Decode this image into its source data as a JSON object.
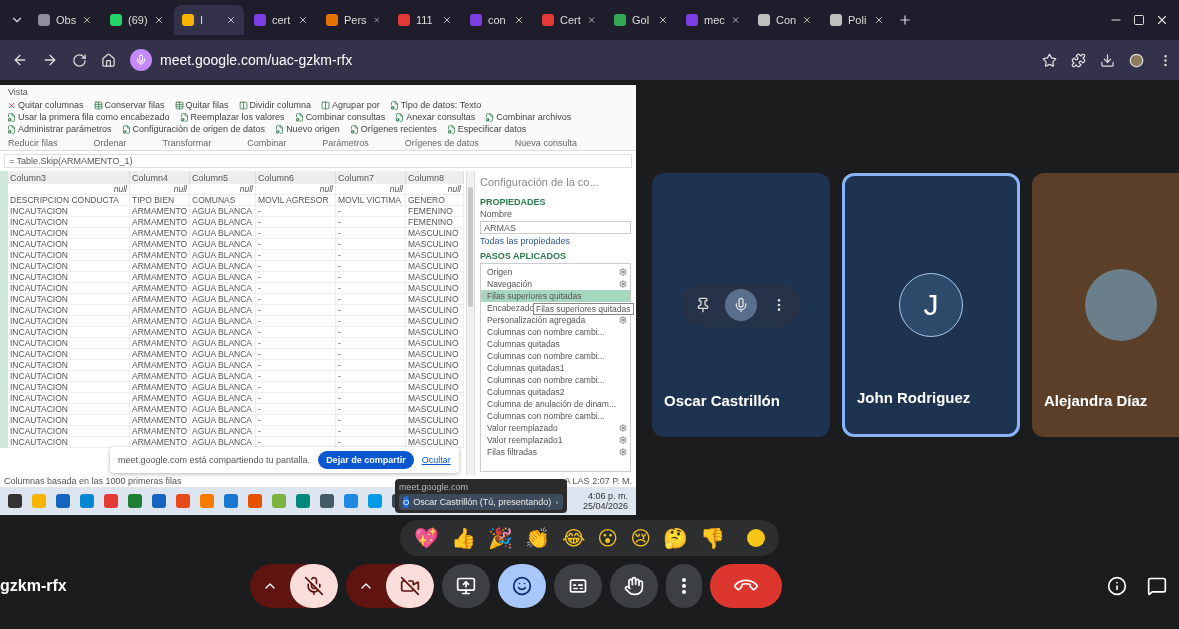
{
  "browser": {
    "tabs": [
      {
        "label": "Obs",
        "color": "#8e8e9e",
        "selected": false
      },
      {
        "label": "(69)",
        "color": "#25d366",
        "selected": false
      },
      {
        "label": "I",
        "color": "#f4b400",
        "selected": true
      },
      {
        "label": "cert",
        "color": "#7b3fe4",
        "selected": false
      },
      {
        "label": "Pers",
        "color": "#e37400",
        "selected": false
      },
      {
        "label": "111",
        "color": "#e53935",
        "selected": false
      },
      {
        "label": "con",
        "color": "#7b3fe4",
        "selected": false
      },
      {
        "label": "Cert",
        "color": "#e53935",
        "selected": false
      },
      {
        "label": "Gol",
        "color": "#34a853",
        "selected": false
      },
      {
        "label": "mec",
        "color": "#7b3fe4",
        "selected": false
      },
      {
        "label": "Con",
        "color": "#c0c0c0",
        "selected": false
      },
      {
        "label": "Poli",
        "color": "#c0c0c0",
        "selected": false
      }
    ],
    "url": "meet.google.com/uac-gzkm-rfx"
  },
  "shared_screen": {
    "ribbon": {
      "tab": "Vista",
      "buttons": [
        "Quitar columnas",
        "Conservar filas",
        "Quitar filas",
        "Dividir columna",
        "Agrupar por",
        "Tipo de datos: Texto",
        "Usar la primera fila como encabezado",
        "Reemplazar los valores",
        "Combinar consultas",
        "Anexar consultas",
        "Combinar archivos",
        "Administrar parámetros",
        "Configuración de origen de datos",
        "Nuevo origen",
        "Orígenes recientes",
        "Especificar datos"
      ],
      "groups": [
        "Reducir filas",
        "Ordenar",
        "Transformar",
        "Combinar",
        "Parámetros",
        "Orígenes de datos",
        "Nueva consulta"
      ]
    },
    "formula": "= Table.Skip(ARMAMENTO_1)",
    "table": {
      "columns": [
        "Column3",
        "Column4",
        "Column5",
        "Column6",
        "Column7",
        "Column8"
      ],
      "null_row": [
        "null",
        "null",
        "null",
        "null",
        "null",
        "null"
      ],
      "rows": [
        [
          "DESCRIPCION CONDUCTA",
          "TIPO BIEN",
          "COMUNAS",
          "MOVIL AGRESOR",
          "MOVIL VICTIMA",
          "GENERO"
        ],
        [
          "INCAUTACION",
          "ARMAMENTO",
          "AGUA BLANCA",
          "-",
          "-",
          "FEMENINO"
        ],
        [
          "INCAUTACION",
          "ARMAMENTO",
          "AGUA BLANCA",
          "-",
          "-",
          "FEMENINO"
        ],
        [
          "INCAUTACION",
          "ARMAMENTO",
          "AGUA BLANCA",
          "-",
          "-",
          "MASCULINO"
        ],
        [
          "INCAUTACION",
          "ARMAMENTO",
          "AGUA BLANCA",
          "-",
          "-",
          "MASCULINO"
        ],
        [
          "INCAUTACION",
          "ARMAMENTO",
          "AGUA BLANCA",
          "-",
          "-",
          "MASCULINO"
        ],
        [
          "INCAUTACION",
          "ARMAMENTO",
          "AGUA BLANCA",
          "-",
          "-",
          "MASCULINO"
        ],
        [
          "INCAUTACION",
          "ARMAMENTO",
          "AGUA BLANCA",
          "-",
          "-",
          "MASCULINO"
        ],
        [
          "INCAUTACION",
          "ARMAMENTO",
          "AGUA BLANCA",
          "-",
          "-",
          "MASCULINO"
        ],
        [
          "INCAUTACION",
          "ARMAMENTO",
          "AGUA BLANCA",
          "-",
          "-",
          "MASCULINO"
        ],
        [
          "INCAUTACION",
          "ARMAMENTO",
          "AGUA BLANCA",
          "-",
          "-",
          "MASCULINO"
        ],
        [
          "INCAUTACION",
          "ARMAMENTO",
          "AGUA BLANCA",
          "-",
          "-",
          "MASCULINO"
        ],
        [
          "INCAUTACION",
          "ARMAMENTO",
          "AGUA BLANCA",
          "-",
          "-",
          "MASCULINO"
        ],
        [
          "INCAUTACION",
          "ARMAMENTO",
          "AGUA BLANCA",
          "-",
          "-",
          "MASCULINO"
        ],
        [
          "INCAUTACION",
          "ARMAMENTO",
          "AGUA BLANCA",
          "-",
          "-",
          "MASCULINO"
        ],
        [
          "INCAUTACION",
          "ARMAMENTO",
          "AGUA BLANCA",
          "-",
          "-",
          "MASCULINO"
        ],
        [
          "INCAUTACION",
          "ARMAMENTO",
          "AGUA BLANCA",
          "-",
          "-",
          "MASCULINO"
        ],
        [
          "INCAUTACION",
          "ARMAMENTO",
          "AGUA BLANCA",
          "-",
          "-",
          "MASCULINO"
        ],
        [
          "INCAUTACION",
          "ARMAMENTO",
          "AGUA BLANCA",
          "-",
          "-",
          "MASCULINO"
        ],
        [
          "INCAUTACION",
          "ARMAMENTO",
          "AGUA BLANCA",
          "-",
          "-",
          "MASCULINO"
        ],
        [
          "INCAUTACION",
          "ARMAMENTO",
          "AGUA BLANCA",
          "-",
          "-",
          "MASCULINO"
        ],
        [
          "INCAUTACION",
          "ARMAMENTO",
          "AGUA BLANCA",
          "-",
          "-",
          "MASCULINO"
        ],
        [
          "INCAUTACION",
          "ARMAMENTO",
          "AGUA BLANCA",
          "-",
          "-",
          "MASCULINO"
        ]
      ]
    },
    "query_settings": {
      "title": "Configuración de la co...",
      "properties_heading": "PROPIEDADES",
      "name_label": "Nombre",
      "name_value": "ARMAS",
      "all_properties": "Todas las propiedades",
      "steps_heading": "PASOS APLICADOS",
      "steps": [
        {
          "label": "Origen",
          "settings": true,
          "selected": false
        },
        {
          "label": "Navegación",
          "settings": true,
          "selected": false
        },
        {
          "label": "Filas superiores quitadas",
          "settings": false,
          "selected": true
        },
        {
          "label": "Encabezado",
          "settings": false,
          "selected": false
        },
        {
          "label": "Personalización agregada",
          "settings": true,
          "selected": false
        },
        {
          "label": "Columnas con nombre cambi...",
          "settings": false,
          "selected": false
        },
        {
          "label": "Columnas quitadas",
          "settings": false,
          "selected": false
        },
        {
          "label": "Columnas con nombre cambi...",
          "settings": false,
          "selected": false
        },
        {
          "label": "Columnas quitadas1",
          "settings": false,
          "selected": false
        },
        {
          "label": "Columnas con nombre cambi...",
          "settings": false,
          "selected": false
        },
        {
          "label": "Columnas quitadas2",
          "settings": false,
          "selected": false
        },
        {
          "label": "Columna de anulación de dinam...",
          "settings": false,
          "selected": false
        },
        {
          "label": "Columnas con nombre cambi...",
          "settings": false,
          "selected": false
        },
        {
          "label": "Valor reemplazado",
          "settings": true,
          "selected": false
        },
        {
          "label": "Valor reemplazado1",
          "settings": true,
          "selected": false
        },
        {
          "label": "Filas filtradas",
          "settings": true,
          "selected": false
        }
      ],
      "tooltip": "Filas superiores quitadas"
    },
    "status": "Columnas basada en las 1000 primeras filas",
    "status_right": "A LAS 2:07 P. M.",
    "share_bar": {
      "message": "meet.google.com está compartiendo tu pantalla.",
      "stop": "Dejar de compartir",
      "hide": "Ocultar"
    },
    "taskbar_popup": {
      "title": "meet.google.com",
      "item_initial": "O",
      "item": "Oscar Castrillón (Tú, presentando)"
    },
    "clock": {
      "time": "4:06 p. m.",
      "date": "25/04/2026"
    }
  },
  "participants": [
    {
      "name": "Oscar Castrillón",
      "kind": "hover"
    },
    {
      "name": "John Rodriguez",
      "kind": "initial",
      "initial": "J",
      "speaking": true
    },
    {
      "name": "Alejandra Díaz",
      "kind": "photo",
      "speaking": false
    }
  ],
  "reactions": [
    "💖",
    "👍",
    "🎉",
    "👏",
    "😂",
    "😮",
    "😢",
    "🤔",
    "👎"
  ],
  "meeting_code": "gzkm-rfx",
  "controls": {
    "mic_on": false,
    "camera_on": false,
    "reactions_selected": true
  }
}
